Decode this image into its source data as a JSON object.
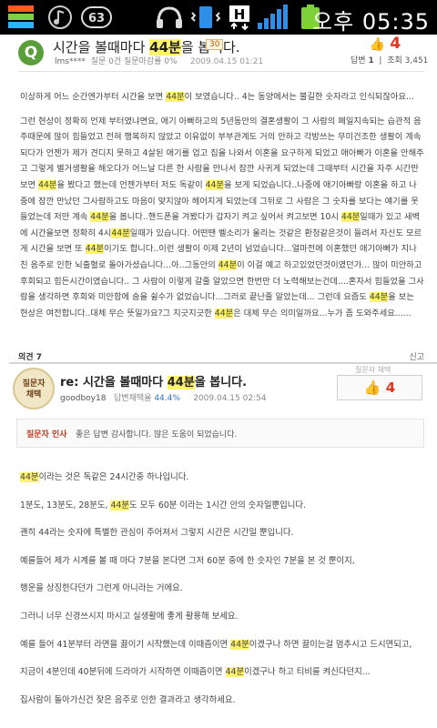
{
  "status_bar": {
    "time": "오후 05:35",
    "icons": [
      "app-grid-icon",
      "music-note-icon",
      "media-63-icon",
      "headphones-icon",
      "phone-vibrate-icon",
      "h-data-icon",
      "signal-bars-icon",
      "battery-icon"
    ]
  },
  "question": {
    "badge": "Q",
    "title_pre": "시간을 볼때마다 ",
    "title_hl": "44분",
    "title_post": "을 봅니다.",
    "points": "30",
    "author": "lms****",
    "meta_rest": "질문 0건 질문마감률 0%",
    "date": "2009.04.15 01:21",
    "votes": "4",
    "answers_label": "답변",
    "answers_count": "1",
    "views_label": "조회",
    "views_count": "3,451",
    "body": [
      [
        "이상하게 어느 순간엔가부터 시간을 보면 ",
        "44분",
        "이 보였습니다.. 4는 동양에서는 불길한 숫자라고 인식되잖아요..."
      ],
      [
        "gap"
      ],
      [
        "그런 현상이 정확히 언제 부터였냐면요, 애기 아빠하고의 5년동안의 결혼생활이 그 사람의 폐일지속되는 습관적 음주때문에 많이 힘들었고 전혀 행복하지 않았고 이유없이 부부관계도 거의 안하고 각방쓰는 무미건조한 생활이 계속 되다가 언젠가 제가 견디지 못하고 4살된 애기를 업고 집을 나와서 이혼을 요구하게 되었고 애아빠가 이혼을 안해주고 그렇게 별거생활을 해오다가 어느날 다른 한 사람을 만나서 잠깐 사귀게 되었는데 그때부터 시간을 자주 시간만보면 ",
        "44분",
        "을 봤다고 했는데 언젠가부터 저도 독같이 ",
        "44분",
        "을 보게 되었습니다..나중에 애기아빠랑 이혼을 하고 나중에 잠깐 만났던 그사람하고도 마음이 맞지않아 헤어지게 되었는데 그뒤로 그 사람은 그 숫자를 보다는 얘기를 못들었는데 저만 계속 ",
        "44분",
        "을 봅니다..핸드폰을 겨봤다가 갑자기 켜고 싶어서 켜고보면 10시 ",
        "44분",
        "일때가 있고 새벽에 시간을보면 정확히 4시",
        "44분",
        "일때가 있습니다. 어떤땐 벨소리가 울리는 것같은 환청같은것이 들려서 자신도 모르게 시간을 보면 또 ",
        "44분",
        "이기도 합니다..이런 생활이 이제 2년이 넘었습니다...얼마전에 이혼했던 애기아빠가 지나친 음주로 인한 뇌출혈로 돌아가셨습니다...아..그동안의 ",
        "44분",
        "이 이걸 예고 하고있었던것이였던가... 많이 미안하고 후회되고 힘든시간이였습니다.. 그 사람이 이렇게 갈줄 알았으면 한번만 더 노력해보는건데....혼자서 힘들었을 그사람을 생각하면 후회와 미안함에 숨을 쉴수가 없었습니다...그러로 끝난줄 알았는데... 그런데 요즘도 ",
        "44분",
        "을 보는 현상은 여전합니다..대체 무슨 뜻일가요?그 지긋지긋한 ",
        "44분",
        "은 대체 무슨 의미일까요...누가 좀 도와주세요......"
      ]
    ],
    "footer_comments": "의견 7",
    "footer_report": "신고"
  },
  "answer": {
    "avatar_line1": "질문자",
    "avatar_line2": "채택",
    "top_hint": "질문자 채택",
    "title_pre": "re: 시간을 볼때마다 ",
    "title_hl": "44분",
    "title_post": "을 봅니다.",
    "author": "goodboy18",
    "rate_label": "답변채택율",
    "rate_value": "44.4%",
    "date": "2009.04.15 02:54",
    "votes": "4",
    "thanks_label": "질문자 인사",
    "thanks_msg": "좋은 답변 감사합니다. 많은 도움이 되었습니다.",
    "body": [
      [
        "",
        "44분",
        "이라는 것은 독같은 24시간중 하나입니다."
      ],
      [
        "1분도, 13분도, 28분도, ",
        "44분",
        "도 모두 60분 이라는 1시간 안의 숫자일뿐입니다."
      ],
      [
        "괜히 44라는 숫자에 특별한 관심이 주어져서 그렇지 시간은 시간일 뿐입니다."
      ],
      [
        "예를들어 제가 시계를 볼 때 마다 7분을 본다면 그저 60분 중에 한 숫자인 7분을 본 것 뿐이지,"
      ],
      [
        "행운을 상징한다던가 그런게 아니라는 거에요."
      ],
      [
        "그러니 너무 신경쓰시지 마시고 실생활에 좋게 활용해 보세요."
      ],
      [
        "예를 들어 41분부터 라면을 끓이기 시작했는데 이때즘이면 ",
        "44분",
        "이겠구나 하면 끓이는걸 멈추시고 드시면되고,"
      ],
      [
        "지금이 4분인데 40분뒤에 드라마가 시작하면 이때즘이면 ",
        "44분",
        "이겠구나 하고 티비를 켜신다던지..."
      ],
      [
        "집사람이 돌아가신건 잦은 음주로 인한 결과라고 생각하세요."
      ]
    ]
  }
}
